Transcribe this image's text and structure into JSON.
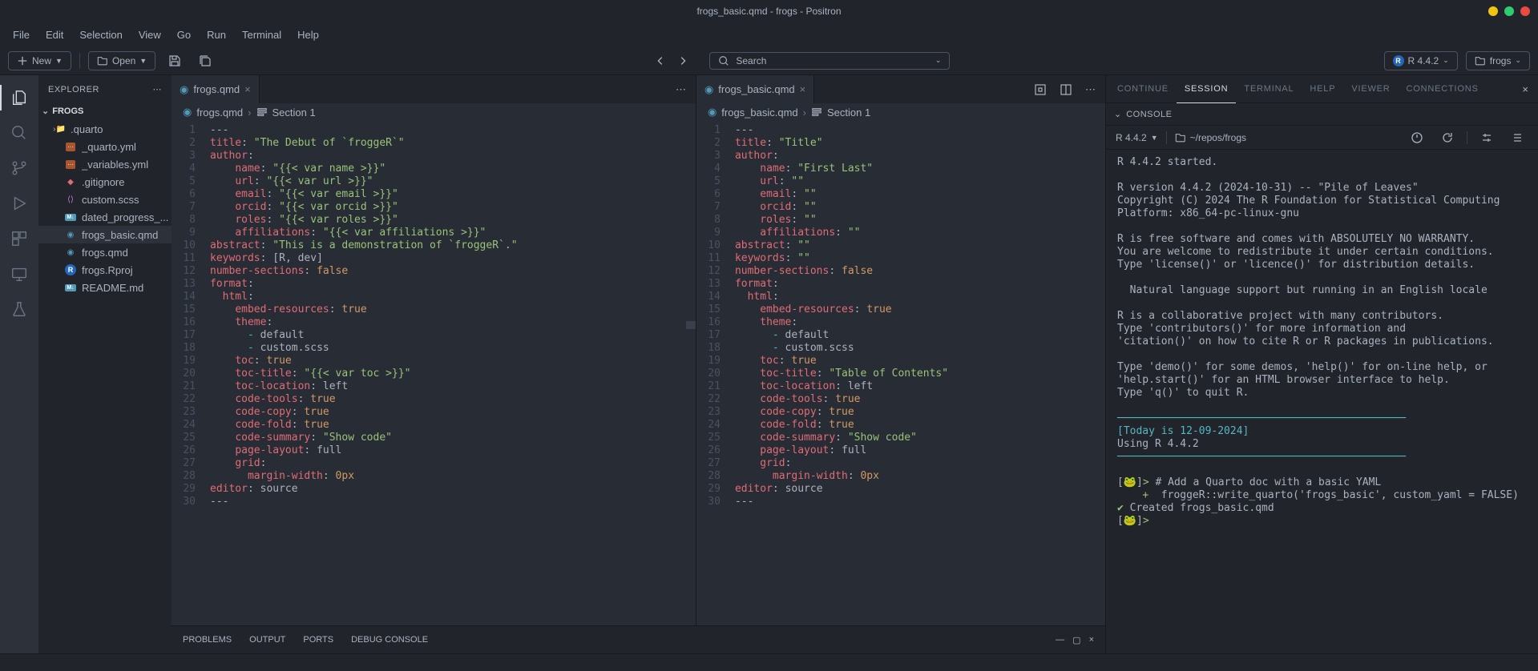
{
  "titlebar": {
    "title": "frogs_basic.qmd - frogs - Positron"
  },
  "menu": [
    "File",
    "Edit",
    "Selection",
    "View",
    "Go",
    "Run",
    "Terminal",
    "Help"
  ],
  "toolbar": {
    "new": "New",
    "open": "Open",
    "search_placeholder": "Search",
    "interpreter": "R 4.4.2",
    "workspace": "frogs"
  },
  "sidebar": {
    "title": "EXPLORER",
    "section": "FROGS",
    "files": [
      {
        "name": ".quarto",
        "icon": "folder",
        "kind": "folder"
      },
      {
        "name": "_quarto.yml",
        "icon": "yml"
      },
      {
        "name": "_variables.yml",
        "icon": "yml"
      },
      {
        "name": ".gitignore",
        "icon": "git"
      },
      {
        "name": "custom.scss",
        "icon": "scss"
      },
      {
        "name": "dated_progress_...",
        "icon": "md"
      },
      {
        "name": "frogs_basic.qmd",
        "icon": "qmd",
        "selected": true
      },
      {
        "name": "frogs.qmd",
        "icon": "qmd"
      },
      {
        "name": "frogs.Rproj",
        "icon": "rproj"
      },
      {
        "name": "README.md",
        "icon": "md"
      }
    ]
  },
  "editor_left": {
    "tab": "frogs.qmd",
    "crumb_file": "frogs.qmd",
    "crumb_section": "Section 1",
    "lines": [
      [
        {
          "t": "punc",
          "v": "---"
        }
      ],
      [
        {
          "t": "key",
          "v": "title"
        },
        {
          "t": "punc",
          "v": ": "
        },
        {
          "t": "str",
          "v": "\"The Debut of `froggeR`\""
        }
      ],
      [
        {
          "t": "key",
          "v": "author"
        },
        {
          "t": "punc",
          "v": ":"
        }
      ],
      [
        {
          "t": "default",
          "v": "    "
        },
        {
          "t": "key",
          "v": "name"
        },
        {
          "t": "punc",
          "v": ": "
        },
        {
          "t": "str",
          "v": "\"{{< var name >}}\""
        }
      ],
      [
        {
          "t": "default",
          "v": "    "
        },
        {
          "t": "key",
          "v": "url"
        },
        {
          "t": "punc",
          "v": ": "
        },
        {
          "t": "str",
          "v": "\"{{< var url >}}\""
        }
      ],
      [
        {
          "t": "default",
          "v": "    "
        },
        {
          "t": "key",
          "v": "email"
        },
        {
          "t": "punc",
          "v": ": "
        },
        {
          "t": "str",
          "v": "\"{{< var email >}}\""
        }
      ],
      [
        {
          "t": "default",
          "v": "    "
        },
        {
          "t": "key",
          "v": "orcid"
        },
        {
          "t": "punc",
          "v": ": "
        },
        {
          "t": "str",
          "v": "\"{{< var orcid >}}\""
        }
      ],
      [
        {
          "t": "default",
          "v": "    "
        },
        {
          "t": "key",
          "v": "roles"
        },
        {
          "t": "punc",
          "v": ": "
        },
        {
          "t": "str",
          "v": "\"{{< var roles >}}\""
        }
      ],
      [
        {
          "t": "default",
          "v": "    "
        },
        {
          "t": "key",
          "v": "affiliations"
        },
        {
          "t": "punc",
          "v": ": "
        },
        {
          "t": "str",
          "v": "\"{{< var affiliations >}}\""
        }
      ],
      [
        {
          "t": "key",
          "v": "abstract"
        },
        {
          "t": "punc",
          "v": ": "
        },
        {
          "t": "str",
          "v": "\"This is a demonstration of `froggeR`.\""
        }
      ],
      [
        {
          "t": "key",
          "v": "keywords"
        },
        {
          "t": "punc",
          "v": ": ["
        },
        {
          "t": "default",
          "v": "R"
        },
        {
          "t": "punc",
          "v": ", "
        },
        {
          "t": "default",
          "v": "dev"
        },
        {
          "t": "punc",
          "v": "]"
        }
      ],
      [
        {
          "t": "key",
          "v": "number-sections"
        },
        {
          "t": "punc",
          "v": ": "
        },
        {
          "t": "bool",
          "v": "false"
        }
      ],
      [
        {
          "t": "key",
          "v": "format"
        },
        {
          "t": "punc",
          "v": ":"
        }
      ],
      [
        {
          "t": "default",
          "v": "  "
        },
        {
          "t": "key",
          "v": "html"
        },
        {
          "t": "punc",
          "v": ":"
        }
      ],
      [
        {
          "t": "default",
          "v": "    "
        },
        {
          "t": "key",
          "v": "embed-resources"
        },
        {
          "t": "punc",
          "v": ": "
        },
        {
          "t": "bool",
          "v": "true"
        }
      ],
      [
        {
          "t": "default",
          "v": "    "
        },
        {
          "t": "key",
          "v": "theme"
        },
        {
          "t": "punc",
          "v": ":"
        }
      ],
      [
        {
          "t": "default",
          "v": "      "
        },
        {
          "t": "dash",
          "v": "-"
        },
        {
          "t": "default",
          "v": " default"
        }
      ],
      [
        {
          "t": "default",
          "v": "      "
        },
        {
          "t": "dash",
          "v": "-"
        },
        {
          "t": "default",
          "v": " custom.scss"
        }
      ],
      [
        {
          "t": "default",
          "v": "    "
        },
        {
          "t": "key",
          "v": "toc"
        },
        {
          "t": "punc",
          "v": ": "
        },
        {
          "t": "bool",
          "v": "true"
        }
      ],
      [
        {
          "t": "default",
          "v": "    "
        },
        {
          "t": "key",
          "v": "toc-title"
        },
        {
          "t": "punc",
          "v": ": "
        },
        {
          "t": "str",
          "v": "\"{{< var toc >}}\""
        }
      ],
      [
        {
          "t": "default",
          "v": "    "
        },
        {
          "t": "key",
          "v": "toc-location"
        },
        {
          "t": "punc",
          "v": ": "
        },
        {
          "t": "default",
          "v": "left"
        }
      ],
      [
        {
          "t": "default",
          "v": "    "
        },
        {
          "t": "key",
          "v": "code-tools"
        },
        {
          "t": "punc",
          "v": ": "
        },
        {
          "t": "bool",
          "v": "true"
        }
      ],
      [
        {
          "t": "default",
          "v": "    "
        },
        {
          "t": "key",
          "v": "code-copy"
        },
        {
          "t": "punc",
          "v": ": "
        },
        {
          "t": "bool",
          "v": "true"
        }
      ],
      [
        {
          "t": "default",
          "v": "    "
        },
        {
          "t": "key",
          "v": "code-fold"
        },
        {
          "t": "punc",
          "v": ": "
        },
        {
          "t": "bool",
          "v": "true"
        }
      ],
      [
        {
          "t": "default",
          "v": "    "
        },
        {
          "t": "key",
          "v": "code-summary"
        },
        {
          "t": "punc",
          "v": ": "
        },
        {
          "t": "str",
          "v": "\"Show code\""
        }
      ],
      [
        {
          "t": "default",
          "v": "    "
        },
        {
          "t": "key",
          "v": "page-layout"
        },
        {
          "t": "punc",
          "v": ": "
        },
        {
          "t": "default",
          "v": "full"
        }
      ],
      [
        {
          "t": "default",
          "v": "    "
        },
        {
          "t": "key",
          "v": "grid"
        },
        {
          "t": "punc",
          "v": ":"
        }
      ],
      [
        {
          "t": "default",
          "v": "      "
        },
        {
          "t": "key",
          "v": "margin-width"
        },
        {
          "t": "punc",
          "v": ": "
        },
        {
          "t": "num",
          "v": "0px"
        }
      ],
      [
        {
          "t": "key",
          "v": "editor"
        },
        {
          "t": "punc",
          "v": ": "
        },
        {
          "t": "default",
          "v": "source"
        }
      ],
      [
        {
          "t": "punc",
          "v": "---"
        }
      ]
    ]
  },
  "editor_right": {
    "tab": "frogs_basic.qmd",
    "crumb_file": "frogs_basic.qmd",
    "crumb_section": "Section 1",
    "lines": [
      [
        {
          "t": "punc",
          "v": "---"
        }
      ],
      [
        {
          "t": "key",
          "v": "title"
        },
        {
          "t": "punc",
          "v": ": "
        },
        {
          "t": "str",
          "v": "\"Title\""
        }
      ],
      [
        {
          "t": "key",
          "v": "author"
        },
        {
          "t": "punc",
          "v": ":"
        }
      ],
      [
        {
          "t": "default",
          "v": "    "
        },
        {
          "t": "key",
          "v": "name"
        },
        {
          "t": "punc",
          "v": ": "
        },
        {
          "t": "str",
          "v": "\"First Last\""
        }
      ],
      [
        {
          "t": "default",
          "v": "    "
        },
        {
          "t": "key",
          "v": "url"
        },
        {
          "t": "punc",
          "v": ": "
        },
        {
          "t": "str",
          "v": "\"\""
        }
      ],
      [
        {
          "t": "default",
          "v": "    "
        },
        {
          "t": "key",
          "v": "email"
        },
        {
          "t": "punc",
          "v": ": "
        },
        {
          "t": "str",
          "v": "\"\""
        }
      ],
      [
        {
          "t": "default",
          "v": "    "
        },
        {
          "t": "key",
          "v": "orcid"
        },
        {
          "t": "punc",
          "v": ": "
        },
        {
          "t": "str",
          "v": "\"\""
        }
      ],
      [
        {
          "t": "default",
          "v": "    "
        },
        {
          "t": "key",
          "v": "roles"
        },
        {
          "t": "punc",
          "v": ": "
        },
        {
          "t": "str",
          "v": "\"\""
        }
      ],
      [
        {
          "t": "default",
          "v": "    "
        },
        {
          "t": "key",
          "v": "affiliations"
        },
        {
          "t": "punc",
          "v": ": "
        },
        {
          "t": "str",
          "v": "\"\""
        }
      ],
      [
        {
          "t": "key",
          "v": "abstract"
        },
        {
          "t": "punc",
          "v": ": "
        },
        {
          "t": "str",
          "v": "\"\""
        }
      ],
      [
        {
          "t": "key",
          "v": "keywords"
        },
        {
          "t": "punc",
          "v": ": "
        },
        {
          "t": "str",
          "v": "\"\""
        }
      ],
      [
        {
          "t": "key",
          "v": "number-sections"
        },
        {
          "t": "punc",
          "v": ": "
        },
        {
          "t": "bool",
          "v": "false"
        }
      ],
      [
        {
          "t": "key",
          "v": "format"
        },
        {
          "t": "punc",
          "v": ":"
        }
      ],
      [
        {
          "t": "default",
          "v": "  "
        },
        {
          "t": "key",
          "v": "html"
        },
        {
          "t": "punc",
          "v": ":"
        }
      ],
      [
        {
          "t": "default",
          "v": "    "
        },
        {
          "t": "key",
          "v": "embed-resources"
        },
        {
          "t": "punc",
          "v": ": "
        },
        {
          "t": "bool",
          "v": "true"
        }
      ],
      [
        {
          "t": "default",
          "v": "    "
        },
        {
          "t": "key",
          "v": "theme"
        },
        {
          "t": "punc",
          "v": ":"
        }
      ],
      [
        {
          "t": "default",
          "v": "      "
        },
        {
          "t": "dash",
          "v": "-"
        },
        {
          "t": "default",
          "v": " default"
        }
      ],
      [
        {
          "t": "default",
          "v": "      "
        },
        {
          "t": "dash",
          "v": "-"
        },
        {
          "t": "default",
          "v": " custom.scss"
        }
      ],
      [
        {
          "t": "default",
          "v": "    "
        },
        {
          "t": "key",
          "v": "toc"
        },
        {
          "t": "punc",
          "v": ": "
        },
        {
          "t": "bool",
          "v": "true"
        }
      ],
      [
        {
          "t": "default",
          "v": "    "
        },
        {
          "t": "key",
          "v": "toc-title"
        },
        {
          "t": "punc",
          "v": ": "
        },
        {
          "t": "str",
          "v": "\"Table of Contents\""
        }
      ],
      [
        {
          "t": "default",
          "v": "    "
        },
        {
          "t": "key",
          "v": "toc-location"
        },
        {
          "t": "punc",
          "v": ": "
        },
        {
          "t": "default",
          "v": "left"
        }
      ],
      [
        {
          "t": "default",
          "v": "    "
        },
        {
          "t": "key",
          "v": "code-tools"
        },
        {
          "t": "punc",
          "v": ": "
        },
        {
          "t": "bool",
          "v": "true"
        }
      ],
      [
        {
          "t": "default",
          "v": "    "
        },
        {
          "t": "key",
          "v": "code-copy"
        },
        {
          "t": "punc",
          "v": ": "
        },
        {
          "t": "bool",
          "v": "true"
        }
      ],
      [
        {
          "t": "default",
          "v": "    "
        },
        {
          "t": "key",
          "v": "code-fold"
        },
        {
          "t": "punc",
          "v": ": "
        },
        {
          "t": "bool",
          "v": "true"
        }
      ],
      [
        {
          "t": "default",
          "v": "    "
        },
        {
          "t": "key",
          "v": "code-summary"
        },
        {
          "t": "punc",
          "v": ": "
        },
        {
          "t": "str",
          "v": "\"Show code\""
        }
      ],
      [
        {
          "t": "default",
          "v": "    "
        },
        {
          "t": "key",
          "v": "page-layout"
        },
        {
          "t": "punc",
          "v": ": "
        },
        {
          "t": "default",
          "v": "full"
        }
      ],
      [
        {
          "t": "default",
          "v": "    "
        },
        {
          "t": "key",
          "v": "grid"
        },
        {
          "t": "punc",
          "v": ":"
        }
      ],
      [
        {
          "t": "default",
          "v": "      "
        },
        {
          "t": "key",
          "v": "margin-width"
        },
        {
          "t": "punc",
          "v": ": "
        },
        {
          "t": "num",
          "v": "0px"
        }
      ],
      [
        {
          "t": "key",
          "v": "editor"
        },
        {
          "t": "punc",
          "v": ": "
        },
        {
          "t": "default",
          "v": "source"
        }
      ],
      [
        {
          "t": "punc",
          "v": "---"
        }
      ]
    ]
  },
  "rightpane": {
    "tabs": [
      "CONTINUE",
      "SESSION",
      "TERMINAL",
      "HELP",
      "VIEWER",
      "CONNECTIONS"
    ],
    "active_tab": "SESSION",
    "console_label": "CONSOLE",
    "interpreter": "R 4.4.2",
    "cwd": "~/repos/frogs",
    "output": "R 4.4.2 started.\n\nR version 4.4.2 (2024-10-31) -- \"Pile of Leaves\"\nCopyright (C) 2024 The R Foundation for Statistical Computing\nPlatform: x86_64-pc-linux-gnu\n\nR is free software and comes with ABSOLUTELY NO WARRANTY.\nYou are welcome to redistribute it under certain conditions.\nType 'license()' or 'licence()' for distribution details.\n\n  Natural language support but running in an English locale\n\nR is a collaborative project with many contributors.\nType 'contributors()' for more information and\n'citation()' on how to cite R or R packages in publications.\n\nType 'demo()' for some demos, 'help()' for on-line help, or\n'help.start()' for an HTML browser interface to help.\nType 'q()' to quit R.\n",
    "hr": "──────────────────────────────────────────────",
    "date_line": "[Today is 12-09-2024]",
    "using_line": "Using R 4.4.2",
    "cmd1": "# Add a Quarto doc with a basic YAML",
    "cmd2": "froggeR::write_quarto('frogs_basic', custom_yaml = FALSE)",
    "created": "Created frogs_basic.qmd"
  },
  "bottompanel": {
    "tabs": [
      "PROBLEMS",
      "OUTPUT",
      "PORTS",
      "DEBUG CONSOLE"
    ]
  }
}
